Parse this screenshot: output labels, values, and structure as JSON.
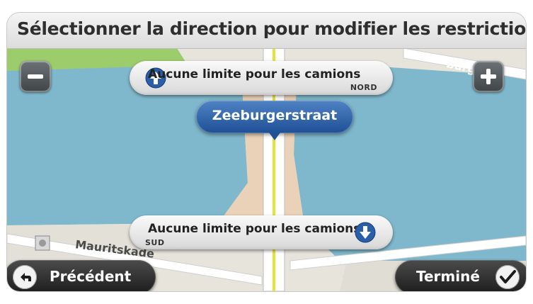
{
  "header": {
    "title": "Sélectionner la direction pour modifier les restrictio"
  },
  "map": {
    "labels": {
      "street_left": "Mauritskade",
      "street_top_right": "burgerpl"
    },
    "colors": {
      "water": "#7fb8cc",
      "land": "#e7e4dc",
      "park": "#9ccc6b",
      "road": "#ffffff",
      "road_accent": "#e8e23a"
    }
  },
  "zoom": {
    "out_icon": "minus-icon",
    "in_icon": "plus-icon"
  },
  "restrictions": {
    "north": {
      "label": "Aucune limite pour les camions",
      "direction": "NORD",
      "icon": "arrow-up-icon"
    },
    "south": {
      "label": "Aucune limite pour les camions",
      "direction": "SUD",
      "icon": "arrow-down-icon"
    }
  },
  "selected_street": {
    "name": "Zeeburgerstraat"
  },
  "footer": {
    "back_label": "Précédent",
    "done_label": "Terminé"
  },
  "accent_color": "#2a5ea8"
}
